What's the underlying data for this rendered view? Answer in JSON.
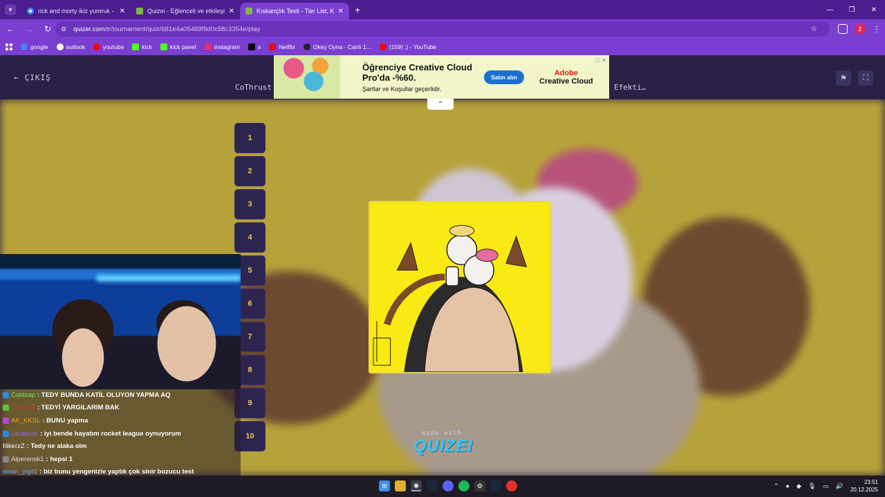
{
  "browser": {
    "tabs": [
      {
        "title": "rick and morty ikiz yumruk - Go",
        "icon": "google-icon",
        "active": false
      },
      {
        "title": "Quizei - Eğlenceli ve etkileşimli",
        "icon": "quizei-icon",
        "active": false
      },
      {
        "title": "Kıskançlık Testi - Tier List, Kör S",
        "icon": "quizei-icon",
        "active": true
      }
    ],
    "new_tab": "+",
    "url_host": "quizei.com",
    "url_path": "/tr/tournament/quiz/681e4a05489f9d0c58c3354e/play",
    "profile_initial": "Z",
    "bookmarks": [
      {
        "label": "google",
        "color": "#4285f4"
      },
      {
        "label": "outlook",
        "color": "#ffffff"
      },
      {
        "label": "youtube",
        "color": "#ff0000"
      },
      {
        "label": "kick",
        "color": "#53fc18"
      },
      {
        "label": "kick panel",
        "color": "#53fc18"
      },
      {
        "label": "instagram",
        "color": "#e1306c"
      },
      {
        "label": "x",
        "color": "#000000"
      },
      {
        "label": "Netflix",
        "color": "#e50914"
      },
      {
        "label": "Okey Oyna - Canlı 1...",
        "color": "#222222"
      },
      {
        "label": "(159) ;) - YouTube",
        "color": "#ff0000"
      }
    ]
  },
  "page": {
    "exit_label": "ÇIKIŞ",
    "title_left": "CoThrust",
    "title_right": "Efekti…",
    "ranks": [
      "1",
      "2",
      "3",
      "4",
      "5",
      "6",
      "7",
      "8",
      "9",
      "10"
    ],
    "made_with": "made with",
    "logo": "QUIZEI"
  },
  "ad": {
    "headline": "Öğrenciye Creative Cloud Pro'da -%60.",
    "subline": "Şartlar ve Koşullar geçerlidir.",
    "button": "Satın alın",
    "brand_1": "Adobe",
    "brand_2": "Creative Cloud"
  },
  "chat": [
    {
      "user": "Coldzap",
      "msg": ": TEDY BUNDA KATİL OLUYON YAPMA AQ",
      "color": "#7cf06a",
      "badge": "#2a8be0"
    },
    {
      "user": "TheEAZ",
      "msg": ": TEDYİ YARGILARIM BAK",
      "color": "#e02b2b",
      "badge": "#5fbf3a"
    },
    {
      "user": "AK_KKSL",
      "msg": ": BUNU yapma",
      "color": "#f0a030",
      "badge": "#b04ad8"
    },
    {
      "user": "Lautecan",
      "msg": ": iyi bende hayatım rocket league oynuyorum",
      "color": "#9a6cf0",
      "badge": "#2a8be0"
    },
    {
      "user": "f4kerzZ",
      "msg": ": Tedy ne alaka olm",
      "color": "#ffffff",
      "badge": ""
    },
    {
      "user": "Alperensk1",
      "msg": ": hepsi 1",
      "color": "#e6d8f0",
      "badge": "#888888"
    },
    {
      "user": "sinan_yigit1",
      "msg": ": biz bunu yengenizle yaptık çok sinir bozucu test",
      "color": "#6aa8f0",
      "badge": ""
    }
  ],
  "taskbar": {
    "time": "23:51",
    "date": "20.12.2025"
  }
}
